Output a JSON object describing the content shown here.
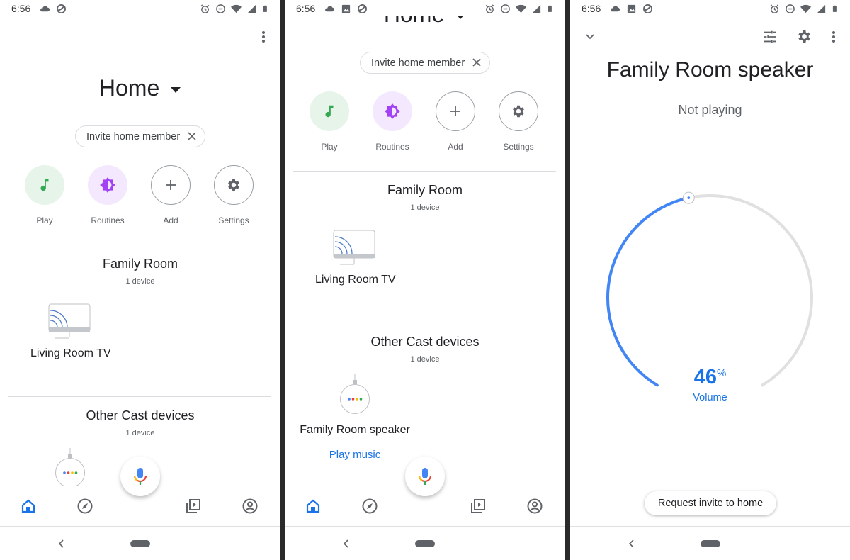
{
  "status_bar": {
    "time": "6:56"
  },
  "home": {
    "title": "Home",
    "invite_chip": "Invite home member",
    "actions": [
      {
        "label": "Play",
        "icon": "music-note-icon"
      },
      {
        "label": "Routines",
        "icon": "routines-icon"
      },
      {
        "label": "Add",
        "icon": "plus-icon"
      },
      {
        "label": "Settings",
        "icon": "gear-icon"
      }
    ],
    "rooms": [
      {
        "name": "Family Room",
        "count": "1 device",
        "devices": [
          {
            "name": "Living Room TV",
            "icon": "cast-tv-icon"
          }
        ]
      },
      {
        "name": "Other Cast devices",
        "count": "1 device",
        "devices": [
          {
            "name": "Family Room speaker",
            "icon": "smart-speaker-icon",
            "action": "Play music"
          }
        ]
      }
    ],
    "bottom_nav": [
      "home-icon",
      "discover-icon",
      "media-icon",
      "account-icon"
    ],
    "active_tab": "home"
  },
  "speaker": {
    "title": "Family Room speaker",
    "status": "Not playing",
    "volume": {
      "value": "46",
      "unit": "%",
      "label": "Volume",
      "percent": 46
    },
    "request_button": "Request invite to home"
  },
  "colors": {
    "accent": "#1a73e8",
    "arc": "#4285f4",
    "track": "#e0e0e0",
    "play_bg": "#e6f4ea",
    "play_icon": "#34a853",
    "routines_bg": "#f3e8fd",
    "routines_icon": "#a142f4"
  }
}
